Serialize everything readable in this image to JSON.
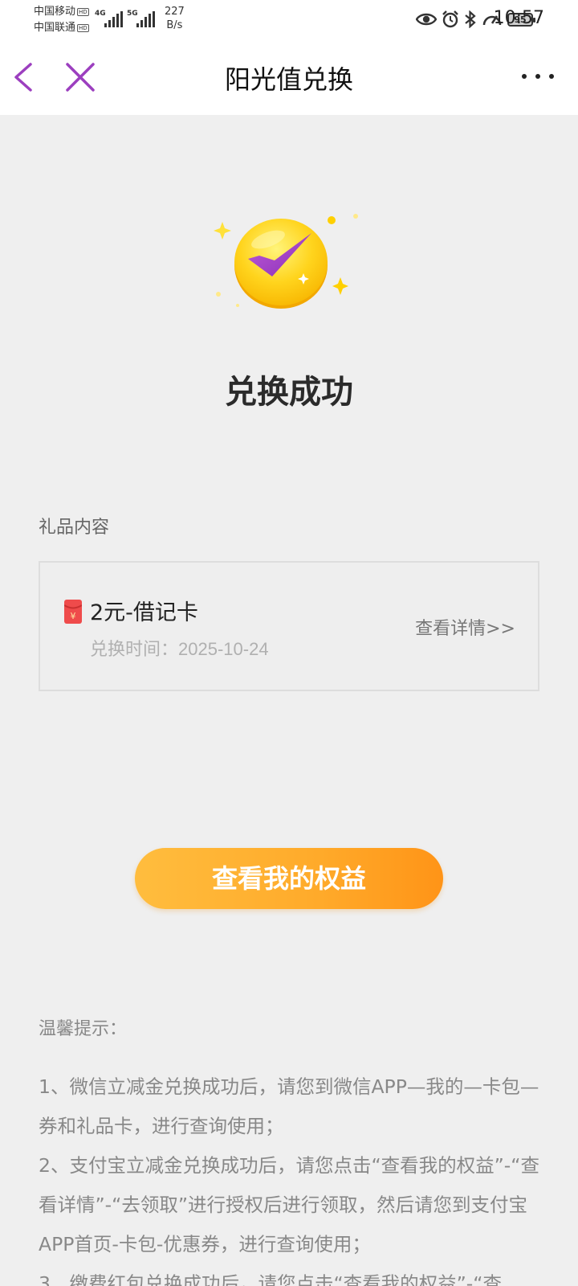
{
  "status_bar": {
    "carrier1": "中国移动",
    "carrier2": "中国联通",
    "hd_badge": "HD",
    "signal1_tag": "4G",
    "signal2_tag": "5G",
    "net_speed_value": "227",
    "net_speed_unit": "B/s",
    "battery": "95",
    "time": "10:57"
  },
  "nav": {
    "title": "阳光值兑换",
    "accent_color": "#9c3fbf"
  },
  "success": {
    "title": "兑换成功"
  },
  "gift": {
    "section_label": "礼品内容",
    "name": "2元-借记卡",
    "time_label": "兑换时间：",
    "time_value": "2025-10-24",
    "detail_link": "查看详情>>",
    "icon_glyph": "¥"
  },
  "primary_button": {
    "label": "查看我的权益"
  },
  "tips": {
    "title": "温馨提示：",
    "items": [
      "1、微信立减金兑换成功后，请您到微信APP—我的—卡包—券和礼品卡，进行查询使用；",
      "2、支付宝立减金兑换成功后，请您点击“查看我的权益”-“查看详情”-“去领取”进行授权后进行领取，然后请您到支付宝APP首页-卡包-优惠券，进行查询使用；",
      "3、缴费红包兑换成功后，请您点击“查看我的权益”-“查"
    ]
  }
}
